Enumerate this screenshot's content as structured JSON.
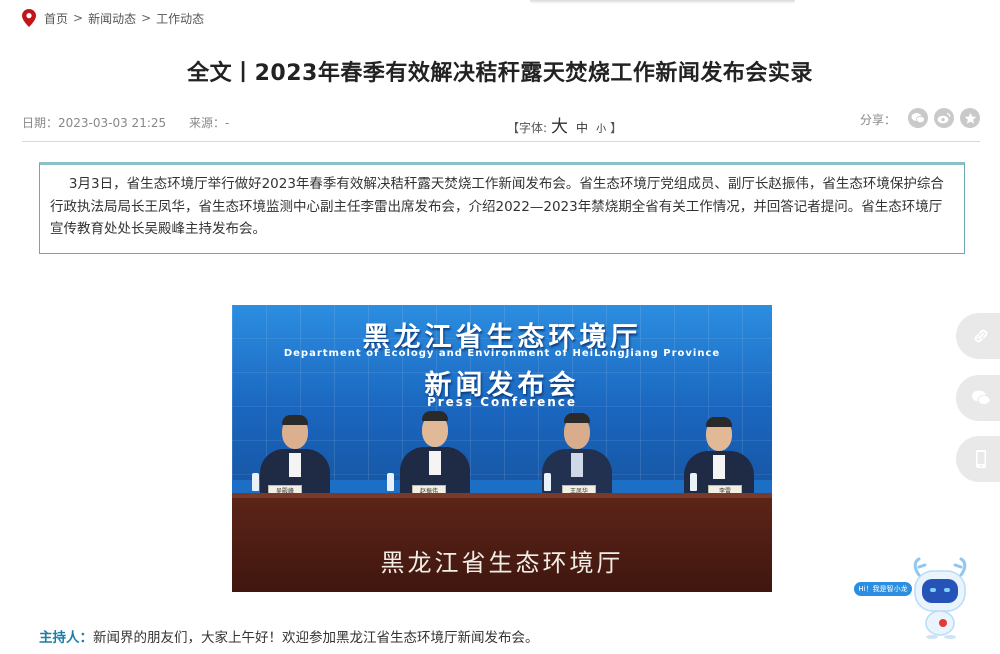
{
  "breadcrumb": {
    "items": [
      "首页",
      "新闻动态",
      "工作动态"
    ],
    "separator": ">"
  },
  "article": {
    "title": "全文丨2023年春季有效解决秸秆露天焚烧工作新闻发布会实录",
    "date": "日期：2023-03-03 21:25",
    "source": "来源：-",
    "font_size_label": "【字体:",
    "font_size_options": [
      "大",
      "中",
      "小"
    ],
    "font_size_close": "】",
    "share_label": "分享：",
    "share_buttons": [
      "wechat-icon",
      "weibo-icon",
      "favorite-icon"
    ],
    "summary": "3月3日，省生态环境厅举行做好2023年春季有效解决秸秆露天焚烧工作新闻发布会。省生态环境厅党组成员、副厅长赵振伟，省生态环境保护综合行政执法局局长王凤华，省生态环境监测中心副主任李雷出席发布会，介绍2022—2023年禁烧期全省有关工作情况，并回答记者提问。省生态环境厅宣传教育处处长吴殿峰主持发布会。",
    "host_label": "主持人：",
    "host_text": "新闻界的朋友们，大家上午好！欢迎参加黑龙江省生态环境厅新闻发布会。"
  },
  "photo": {
    "banner_title": "黑龙江省生态环境厅",
    "banner_en": "Department of Ecology and Environment of HeiLongJiang Province",
    "banner_sub": "新闻发布会",
    "banner_press": "Press Conference",
    "table_text": "黑龙江省生态环境厅",
    "nameplates": [
      "吴殿峰",
      "赵振伟",
      "王凤华",
      "李雷"
    ]
  },
  "side_tools": [
    "link-icon",
    "wechat-icon",
    "mobile-icon"
  ],
  "robot": {
    "tag": "Hi！我是智小龙"
  },
  "colors": {
    "accent": "#1b7ea6",
    "summary_border": "#6fa7b1",
    "banner_blue": "#1a66bf"
  }
}
